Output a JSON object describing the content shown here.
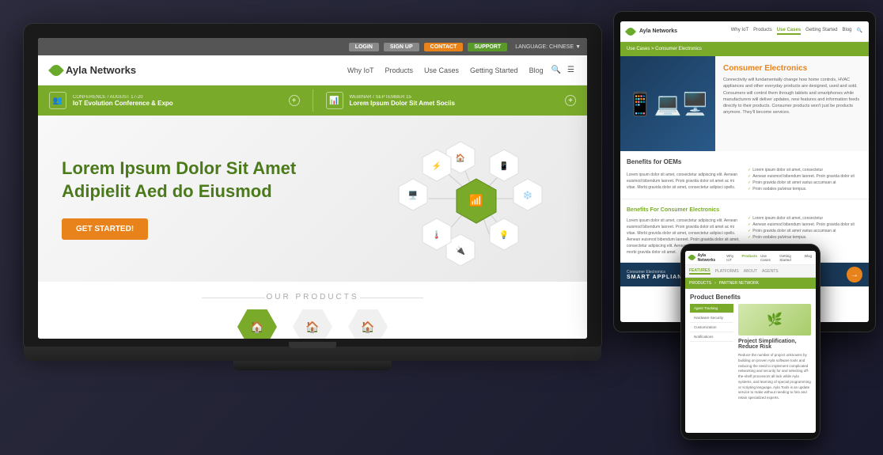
{
  "scene": {
    "background": "#1a1a2e"
  },
  "laptop": {
    "topbar": {
      "login": "LOGIN",
      "signup": "SIGN UP",
      "contact": "CONTACT",
      "support": "SUPPORT",
      "language": "LANGUAGE: CHINESE ▼"
    },
    "nav": {
      "brand": "Ayla Networks",
      "links": [
        "Why IoT",
        "Products",
        "Use Cases",
        "Getting Started",
        "Blog"
      ]
    },
    "banner": {
      "event1": {
        "label": "CONFERENCE / AUGUST 17-20",
        "title": "IoT Evolution Conference & Expo",
        "icon": "👥"
      },
      "event2": {
        "label": "WEBINAR / SEPTEMBER 15",
        "title": "Lorem Ipsum Dolor Sit Amet Sociis",
        "icon": "📊"
      }
    },
    "hero": {
      "headline_line1": "Lorem Ipsum Dolor Sit Amet",
      "headline_line2": "Adipielit Aed do Eiusmod",
      "cta": "GET STARTED!"
    },
    "products": {
      "title": "OUR PRODUCTS",
      "icons": [
        "🏠",
        "🏠",
        "🏠"
      ]
    }
  },
  "tablet": {
    "nav": {
      "brand": "Ayla Networks",
      "links": [
        "Why IoT",
        "Products",
        "Use Cases",
        "Getting Started",
        "Blog"
      ],
      "active": "Use Cases"
    },
    "breadcrumb": "Use Cases > Consumer Electronics",
    "hero": {
      "title": "Consumer Electronics",
      "body": "Connectivity will fundamentally change how home controls, HVAC appliances and other everyday products are designed, used and sold. Consumers will control them through tablets and smartphones while manufacturers will deliver updates, new features and information feeds directly to their products. Consumer products won't just be products anymore. They'll become services."
    },
    "sections": {
      "oems": {
        "title": "Benefits for OEMs",
        "items": [
          "Lorem ipsum dolor sit amet, consectetur adipiscing elit.",
          "Aenean euismod bibendum laoreet. Proin gravida dolor sit",
          "amet ac mi vitae. Morbi gravida dolor sit varius.",
          "Proin sodales pulvinar tempor."
        ]
      },
      "consumer": {
        "title": "Benefits For Consumer Electronics",
        "body": "Lorem ipsum dolor sit amet, consectetur adipiscing elit. Aenean euismod bibendum laoreet. Proin gravida dolor sit amet ac mi vitae. Morbi gravida dolor sit amet, consectetur adipisci spells. Aenean euismod bibendum laoreet. Proin gravida dolor sit amet, consectetur adipiscing elit. Aenean euismod bibendum laoreet. morbi gravida dolor sit amet."
      }
    },
    "banner": {
      "text": "Consumer Electronics",
      "section": "SMART APPLIANCES"
    }
  },
  "phone": {
    "nav": {
      "brand": "Ayla Networks",
      "links": [
        "Why IoT",
        "Products",
        "Use Cases",
        "Getting Started",
        "Blog"
      ],
      "active": "Products"
    },
    "tabs": [
      "FEATURES",
      "PLATFORMS",
      "ABOUT",
      "AGENTS"
    ],
    "breadcrumb": [
      "PRODUCTS",
      "PARTNER NETWORK"
    ],
    "section": {
      "title": "Product Benefits",
      "sidebar_items": [
        "Agent Tracking",
        "Hardware Security",
        "Customization",
        "Notifications"
      ],
      "active_sidebar": "Agent Tracking",
      "content_title": "Project Simplification, Reduce Risk",
      "content_body": "Reduce the number of project unknowns by building on proven Ayla software tools and reducing the need to implement complicated networking and security for and selecting off-the-shelf processors all lack while Ayla systems, and learning of special programming or scripting language. Ayla Tools is an update service to make without needing to hire and retain specialized experts."
    }
  }
}
